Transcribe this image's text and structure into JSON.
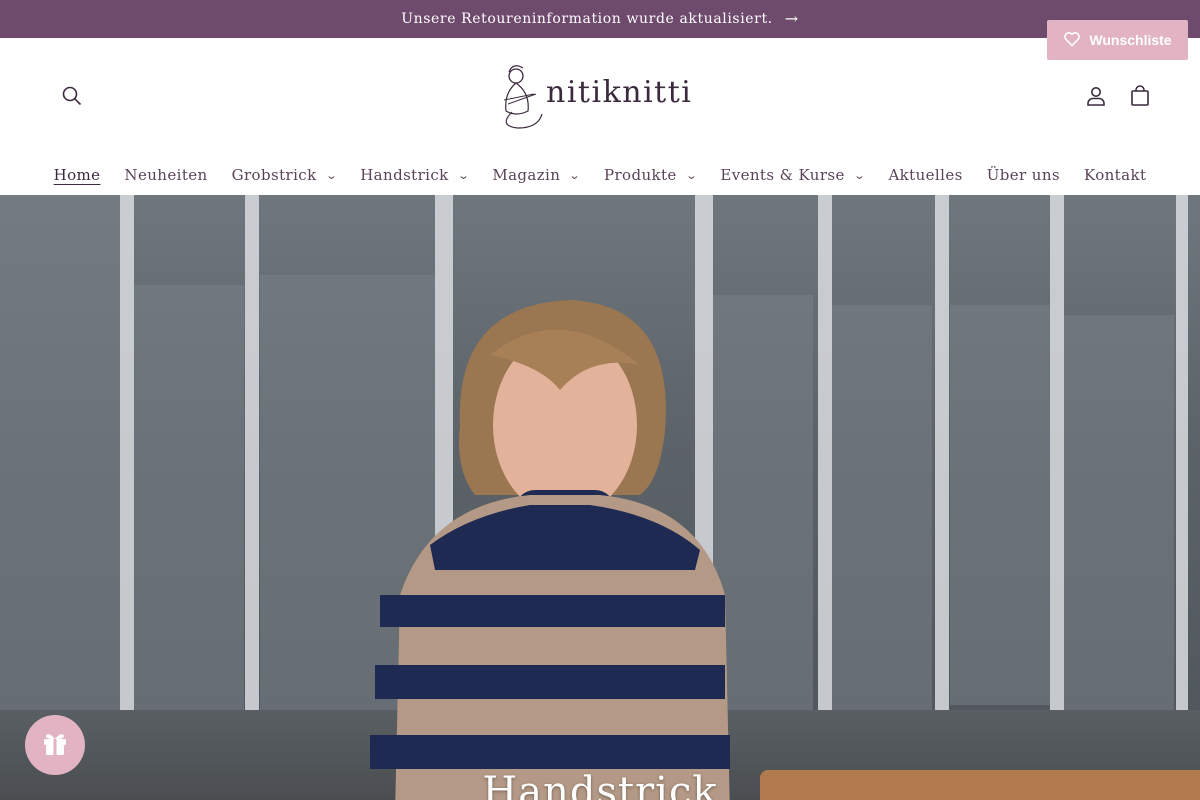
{
  "announcement": {
    "text": "Unsere Retoureninformation wurde aktualisiert.",
    "arrow": "→"
  },
  "wishlist": {
    "label": "Wunschliste",
    "color": "#e2b3c3"
  },
  "header": {
    "logo_text": "nitiknitti",
    "icons": [
      "search-icon",
      "account-icon",
      "cart-icon"
    ]
  },
  "nav": {
    "items": [
      {
        "label": "Home",
        "dropdown": false,
        "active": true
      },
      {
        "label": "Neuheiten",
        "dropdown": false
      },
      {
        "label": "Grobstrick",
        "dropdown": true
      },
      {
        "label": "Handstrick",
        "dropdown": true
      },
      {
        "label": "Magazin",
        "dropdown": true
      },
      {
        "label": "Produkte",
        "dropdown": true
      },
      {
        "label": "Events & Kurse",
        "dropdown": true
      },
      {
        "label": "Aktuelles",
        "dropdown": false
      },
      {
        "label": "Über uns",
        "dropdown": false
      },
      {
        "label": "Kontakt",
        "dropdown": false
      }
    ],
    "chevron": "⌄"
  },
  "hero": {
    "heading": "Handstrick"
  },
  "colors": {
    "announcement_bg": "#6e4a6d",
    "accent_pink": "#e2b3c3",
    "text": "#3b2a3d"
  }
}
